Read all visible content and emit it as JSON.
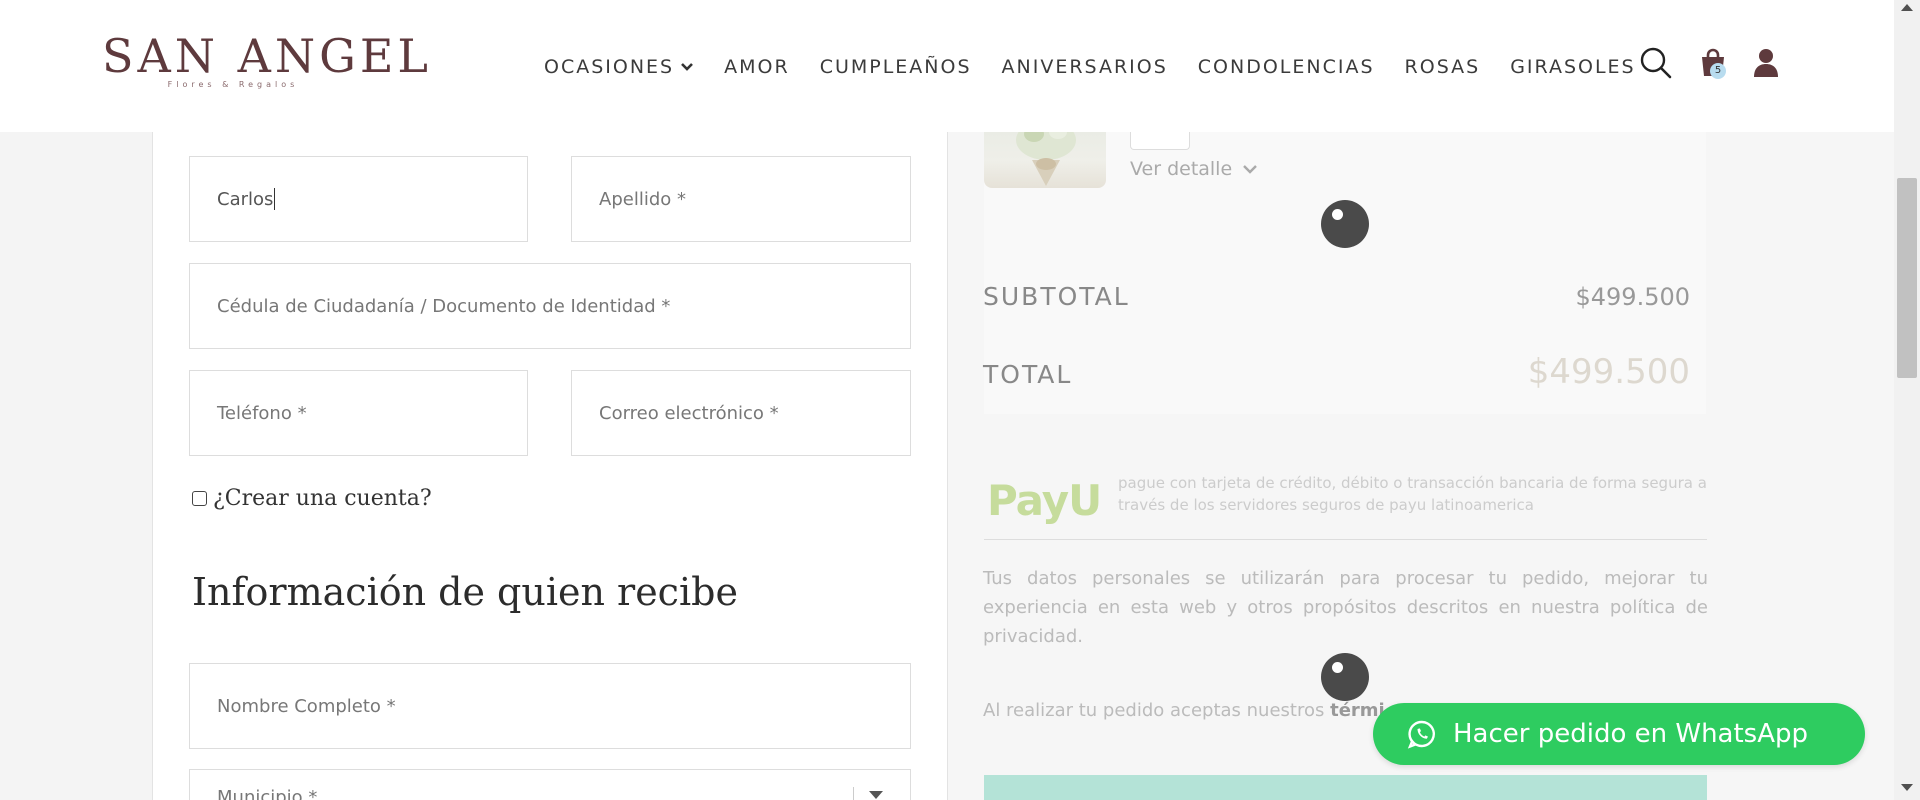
{
  "brand": {
    "name": "SAN ANGEL",
    "tagline": "Flores & Regalos"
  },
  "nav": {
    "items": [
      "OCASIONES",
      "AMOR",
      "CUMPLEAÑOS",
      "ANIVERSARIOS",
      "CONDOLENCIAS",
      "ROSAS",
      "GIRASOLES"
    ],
    "icons": [
      "search-icon",
      "cart-icon",
      "user-icon"
    ],
    "cart_count": "5"
  },
  "form": {
    "first_name_value": "Carlos",
    "last_name_placeholder": "Apellido *",
    "id_placeholder": "Cédula de Ciudadanía / Documento de Identidad *",
    "phone_placeholder": "Teléfono *",
    "email_placeholder": "Correo electrónico *",
    "create_account_label": "¿Crear una cuenta?",
    "recipient_title": "Información de quien recibe",
    "full_name_placeholder": "Nombre Completo *",
    "municipality_placeholder": "Municipio *"
  },
  "order": {
    "view_detail_label": "Ver detalle",
    "subtotal_label": "SUBTOTAL",
    "subtotal_value": "$499.500",
    "total_label": "TOTAL",
    "total_value": "$499.500"
  },
  "payment": {
    "payu_logo": "PayU",
    "payu_description": "pague con tarjeta de crédito, débito o transacción bancaria de forma segura a través de los servidores seguros de payu latinoamerica",
    "privacy_text": "Tus datos personales se utilizarán para procesar tu pedido, mejorar tu experiencia en esta web y otros propósitos descritos en nuestra política de privacidad.",
    "terms_prefix": "Al realizar tu pedido aceptas nuestros ",
    "terms_link": "térmi"
  },
  "whatsapp": {
    "label": "Hacer pedido en WhatsApp"
  },
  "colors": {
    "brand": "#5e3a3d",
    "whatsapp": "#2ecc60",
    "payu": "#c6dc9c",
    "pay_button": "#b4e3d7"
  }
}
